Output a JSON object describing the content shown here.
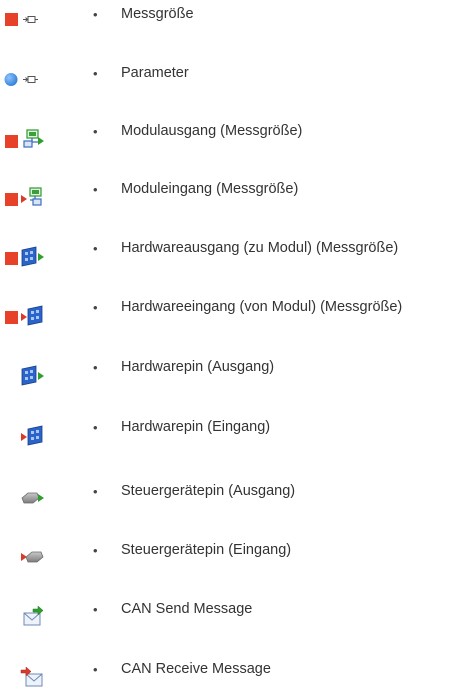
{
  "legend": {
    "bullet": "•",
    "items": [
      {
        "label": "Messgröße",
        "icon": "measurement-icon"
      },
      {
        "label": "Parameter",
        "icon": "parameter-icon"
      },
      {
        "label": "Modulausgang (Messgröße)",
        "icon": "module-output-icon"
      },
      {
        "label": "Moduleingang (Messgröße)",
        "icon": "module-input-icon"
      },
      {
        "label": "Hardwareausgang (zu Modul) (Messgröße)",
        "icon": "hardware-output-icon"
      },
      {
        "label": "Hardwareeingang (von Modul) (Messgröße)",
        "icon": "hardware-input-icon"
      },
      {
        "label": "Hardwarepin (Ausgang)",
        "icon": "hardware-pin-output-icon"
      },
      {
        "label": "Hardwarepin (Eingang)",
        "icon": "hardware-pin-input-icon"
      },
      {
        "label": "Steuergerätepin (Ausgang)",
        "icon": "ecu-pin-output-icon"
      },
      {
        "label": "Steuergerätepin (Eingang)",
        "icon": "ecu-pin-input-icon"
      },
      {
        "label": "CAN Send Message",
        "icon": "can-send-message-icon"
      },
      {
        "label": "CAN Receive Message",
        "icon": "can-receive-message-icon"
      }
    ]
  },
  "colors": {
    "measurement_square": "#e8412a",
    "parameter_dot": "#2f7fd6",
    "module_green": "#3aa13a",
    "hardware_blue": "#2a63c9",
    "pin_arrow_red": "#d93a2a",
    "pin_arrow_green": "#2f9e2f",
    "ecu_gray": "#8a8a8a",
    "envelope": "#8fa6c9"
  }
}
